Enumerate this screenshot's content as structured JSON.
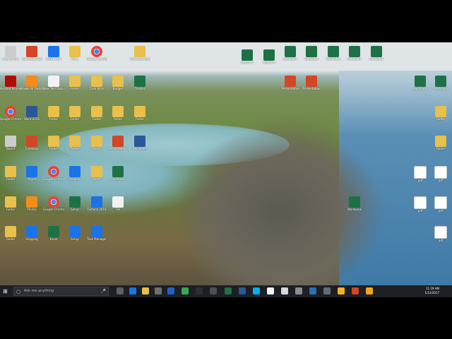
{
  "taskbar": {
    "search_placeholder": "Ask me anything",
    "time": "11:29 AM",
    "date": "1/12/2017",
    "apps": [
      {
        "name": "task-view-icon",
        "color": "#5a5f66",
        "label": "Task View"
      },
      {
        "name": "edge-icon",
        "color": "#1a73e8",
        "label": "Microsoft Edge"
      },
      {
        "name": "folder-icon",
        "color": "#e8c04a",
        "label": "File Explorer"
      },
      {
        "name": "store-icon",
        "color": "#6e6e6e",
        "label": "Store"
      },
      {
        "name": "outlook-icon",
        "color": "#1d63c6",
        "label": "Outlook"
      },
      {
        "name": "chrome-icon",
        "color": "#34a853",
        "label": "Chrome"
      },
      {
        "name": "app-icon",
        "color": "#2b2f36",
        "label": "App"
      },
      {
        "name": "app-icon-2",
        "color": "#4a4f57",
        "label": "App"
      },
      {
        "name": "excel-icon",
        "color": "#1e7145",
        "label": "Excel"
      },
      {
        "name": "word-icon",
        "color": "#2b579a",
        "label": "Word"
      },
      {
        "name": "skype-icon",
        "color": "#00aff0",
        "label": "Skype"
      },
      {
        "name": "file-icon",
        "color": "#f2f2f2",
        "label": "File"
      },
      {
        "name": "doc-icon",
        "color": "#d9d9d9",
        "label": "Doc"
      },
      {
        "name": "calculator-icon",
        "color": "#8c8c8c",
        "label": "Calculator"
      },
      {
        "name": "chart-icon",
        "color": "#2b6fb6",
        "label": "Chart"
      },
      {
        "name": "calc-icon",
        "color": "#5f6b77",
        "label": "Calc"
      },
      {
        "name": "gear-icon",
        "color": "#f2b31c",
        "label": "Settings"
      },
      {
        "name": "powerpoint-icon",
        "color": "#d24726",
        "label": "PowerPoint"
      },
      {
        "name": "sun-icon",
        "color": "#f2a51c",
        "label": "App"
      }
    ]
  },
  "wallpaper_brand": "bing",
  "icons": [
    {
      "id": "i1",
      "label": "Recycle Bin",
      "type": "g-gray"
    },
    {
      "id": "i2",
      "label": "PowerPoint 2016",
      "type": "g-ppt"
    },
    {
      "id": "i3",
      "label": "INTEL UCA",
      "type": "g-blue"
    },
    {
      "id": "i4",
      "label": "Files",
      "type": "g-folder"
    },
    {
      "id": "i5",
      "label": "Google Chrome",
      "type": "g-chrome"
    },
    {
      "id": "i6",
      "label": "3rd Grade Math",
      "type": "g-folder"
    },
    {
      "id": "i7",
      "label": "Acrobat Reader DC",
      "type": "g-pdf"
    },
    {
      "id": "i8",
      "label": "Power BI Desktop",
      "type": "g-orange"
    },
    {
      "id": "i9",
      "label": "New Text Document",
      "type": "g-file"
    },
    {
      "id": "i10",
      "label": "Folder",
      "type": "g-folder"
    },
    {
      "id": "i11",
      "label": "Case Work",
      "type": "g-folder"
    },
    {
      "id": "i12",
      "label": "Budget",
      "type": "g-folder"
    },
    {
      "id": "i13",
      "label": "Tracker",
      "type": "g-excel"
    },
    {
      "id": "i14",
      "label": "Google Chrome",
      "type": "g-chrome"
    },
    {
      "id": "i15",
      "label": "Word 2016",
      "type": "g-word"
    },
    {
      "id": "i16",
      "label": "Folder",
      "type": "g-folder"
    },
    {
      "id": "i17",
      "label": "Folder",
      "type": "g-folder"
    },
    {
      "id": "i18",
      "label": "Folder",
      "type": "g-folder"
    },
    {
      "id": "i19",
      "label": "Folder",
      "type": "g-folder"
    },
    {
      "id": "i20",
      "label": "Folder",
      "type": "g-folder"
    },
    {
      "id": "i21",
      "label": "Report",
      "type": "g-gray"
    },
    {
      "id": "i22",
      "label": "Camtasia",
      "type": "g-ppt"
    },
    {
      "id": "i23",
      "label": "Folder",
      "type": "g-folder"
    },
    {
      "id": "i24",
      "label": "Folder",
      "type": "g-folder"
    },
    {
      "id": "i25",
      "label": "Folder",
      "type": "g-folder"
    },
    {
      "id": "i26",
      "label": "Presentation",
      "type": "g-ppt"
    },
    {
      "id": "i27",
      "label": "Document",
      "type": "g-word"
    },
    {
      "id": "i28",
      "label": "Folder",
      "type": "g-folder"
    },
    {
      "id": "i29",
      "label": "Skype",
      "type": "g-blue"
    },
    {
      "id": "i30",
      "label": "Google Chrome",
      "type": "g-chrome"
    },
    {
      "id": "i31",
      "label": "Dropbox",
      "type": "g-blue"
    },
    {
      "id": "i32",
      "label": "Folder",
      "type": "g-folder"
    },
    {
      "id": "i33",
      "label": "Workbook",
      "type": "g-excel"
    },
    {
      "id": "i34",
      "label": "Folder",
      "type": "g-folder"
    },
    {
      "id": "i35",
      "label": "Photos",
      "type": "g-orange"
    },
    {
      "id": "i36",
      "label": "Google Chrome",
      "type": "g-chrome"
    },
    {
      "id": "i37",
      "label": "Setup",
      "type": "g-excel"
    },
    {
      "id": "i38",
      "label": "Outlook 2016",
      "type": "g-blue"
    },
    {
      "id": "i39",
      "label": "File",
      "type": "g-file"
    },
    {
      "id": "i40",
      "label": "Folder",
      "type": "g-folder"
    },
    {
      "id": "i41",
      "label": "Snipping",
      "type": "g-blue"
    },
    {
      "id": "i42",
      "label": "Excel",
      "type": "g-excel"
    },
    {
      "id": "i43",
      "label": "Setup",
      "type": "g-blue"
    },
    {
      "id": "i44",
      "label": "Task Manager",
      "type": "g-blue"
    },
    {
      "id": "i45",
      "label": "Report 1",
      "type": "g-excel"
    },
    {
      "id": "i46",
      "label": "Report 2",
      "type": "g-excel"
    },
    {
      "id": "i47",
      "label": "Workbook",
      "type": "g-excel"
    },
    {
      "id": "i48",
      "label": "Workbook",
      "type": "g-excel"
    },
    {
      "id": "i49",
      "label": "Workbook",
      "type": "g-excel"
    },
    {
      "id": "i50",
      "label": "Workbook",
      "type": "g-excel"
    },
    {
      "id": "i51",
      "label": "Workbook",
      "type": "g-excel"
    },
    {
      "id": "i52",
      "label": "Presentation",
      "type": "g-ppt"
    },
    {
      "id": "i53",
      "label": "Presentation",
      "type": "g-ppt"
    },
    {
      "id": "i54",
      "label": "Workbook",
      "type": "g-excel"
    },
    {
      "id": "i55",
      "label": "Workbook",
      "type": "g-excel"
    },
    {
      "id": "i56",
      "label": "Folder",
      "type": "g-folder"
    },
    {
      "id": "i57",
      "label": "Folder",
      "type": "g-folder"
    },
    {
      "id": "i58",
      "label": "Workbook",
      "type": "g-excel"
    },
    {
      "id": "i59",
      "label": "pdf",
      "type": "g-pdf2"
    },
    {
      "id": "i60",
      "label": "pdf",
      "type": "g-pdf2"
    },
    {
      "id": "i61",
      "label": "pdf",
      "type": "g-pdf2"
    },
    {
      "id": "i62",
      "label": "pdf",
      "type": "g-pdf2"
    },
    {
      "id": "i63",
      "label": "pdf",
      "type": "g-pdf2"
    }
  ]
}
